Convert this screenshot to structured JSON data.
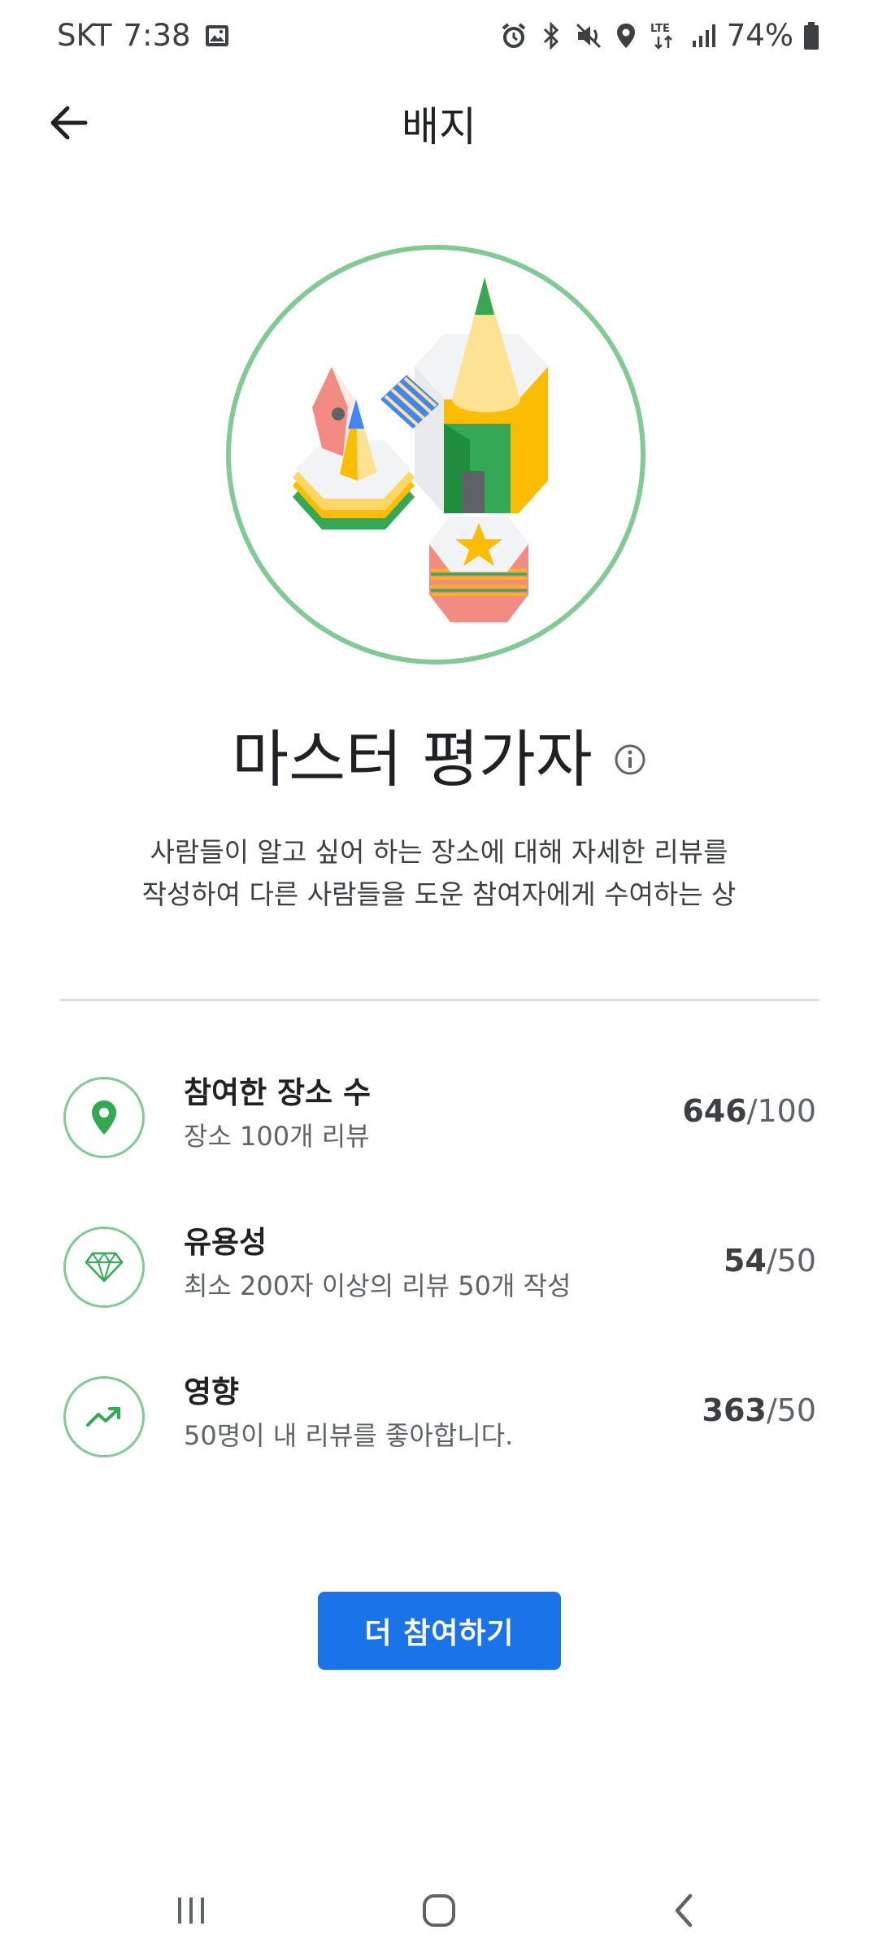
{
  "status_bar": {
    "carrier": "SKT",
    "time": "7:38",
    "network": "LTE",
    "battery": "74%",
    "icons": [
      "gallery-icon",
      "alarm-icon",
      "bluetooth-icon",
      "mute-icon",
      "location-icon",
      "lte-icon",
      "signal-icon",
      "battery-icon"
    ]
  },
  "app_bar": {
    "title": "배지",
    "back_icon": "arrow-back-icon"
  },
  "badge": {
    "title": "마스터 평가자",
    "description_line1": "사람들이 알고 싶어 하는 장소에 대해 자세한 리뷰를",
    "description_line2": "작성하여 다른 사람들을 도운 참여자에게 수여하는 상",
    "ring_color": "#81c995"
  },
  "stats": [
    {
      "icon": "map-pin-icon",
      "title": "참여한 장소 수",
      "subtitle": "장소 100개 리뷰",
      "current": "646",
      "target": "/100"
    },
    {
      "icon": "diamond-icon",
      "title": "유용성",
      "subtitle": "최소 200자 이상의 리뷰 50개 작성",
      "current": "54",
      "target": "/50"
    },
    {
      "icon": "trending-up-icon",
      "title": "영향",
      "subtitle": "50명이 내 리뷰를 좋아합니다.",
      "current": "363",
      "target": "/50"
    }
  ],
  "action": {
    "label": "더 참여하기",
    "color": "#1a73e8"
  },
  "nav_bar": {
    "icons": [
      "recent-apps-icon",
      "home-icon",
      "back-nav-icon"
    ]
  }
}
